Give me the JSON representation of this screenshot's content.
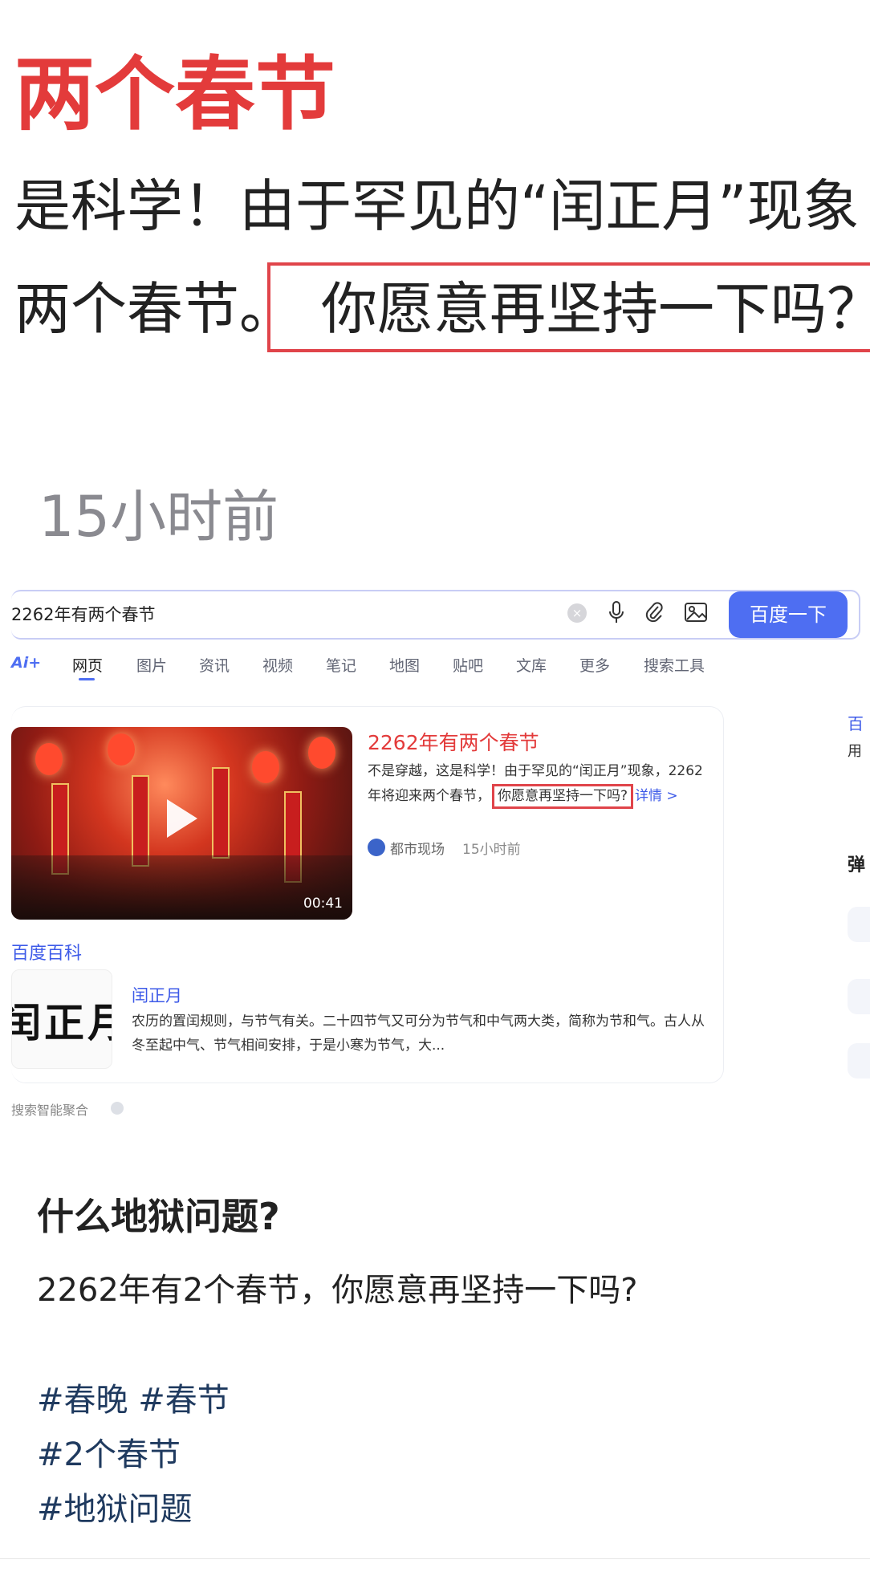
{
  "post": {
    "headline": "两个春节",
    "line1": "是科学！由于罕见的“闰正月”现象",
    "line2_prefix": "两个春节。",
    "line2_boxed": "你愿意再坚持一下吗？",
    "time": "15小时前"
  },
  "screenshot": {
    "search": {
      "query": "2262年有两个春节",
      "clear_icon": "clear-icon",
      "mic_icon": "mic-icon",
      "attach_icon": "paperclip-icon",
      "image_icon": "image-search-icon",
      "button_label": "百度一下",
      "button_color": "#4e6ef2"
    },
    "tabs": [
      {
        "label": "Ai+"
      },
      {
        "label": "网页"
      },
      {
        "label": "图片"
      },
      {
        "label": "资讯"
      },
      {
        "label": "视频"
      },
      {
        "label": "笔记"
      },
      {
        "label": "地图"
      },
      {
        "label": "贴吧"
      },
      {
        "label": "文库"
      },
      {
        "label": "更多"
      },
      {
        "label": "搜索工具"
      }
    ],
    "result": {
      "title": "2262年有两个春节",
      "desc_start": "不是穿越，这是科学！由于罕见的“闰正月”现象，2262年将迎来两个春节，",
      "desc_boxed": "你愿意再坚持一下吗?",
      "desc_link": "详情 >",
      "source": "都市现场",
      "source_time": "15小时前",
      "video_duration": "00:41"
    },
    "baike": {
      "label": "百度百科",
      "image_text": "闰正月",
      "title": "闰正月",
      "desc": "农历的置闰规则，与节气有关。二十四节气又可分为节气和中气两大类，简称为节和气。古人从冬至起中气、节气相间安排，于是小寒为节气，大..."
    },
    "aggregate_label": "搜索智能聚合",
    "side_fragments": [
      "百",
      "用",
      "弹"
    ]
  },
  "body": {
    "question": "什么地狱问题?",
    "text": "2262年有2个春节，你愿意再坚持一下吗?",
    "tags_line1": "#春晚 #春节",
    "tags_line2": "#2个春节",
    "tags_line3": "#地狱问题"
  },
  "colors": {
    "accent_red": "#e33b3b",
    "link_blue": "#3d5ae8",
    "hashtag": "#1f3a5f"
  }
}
